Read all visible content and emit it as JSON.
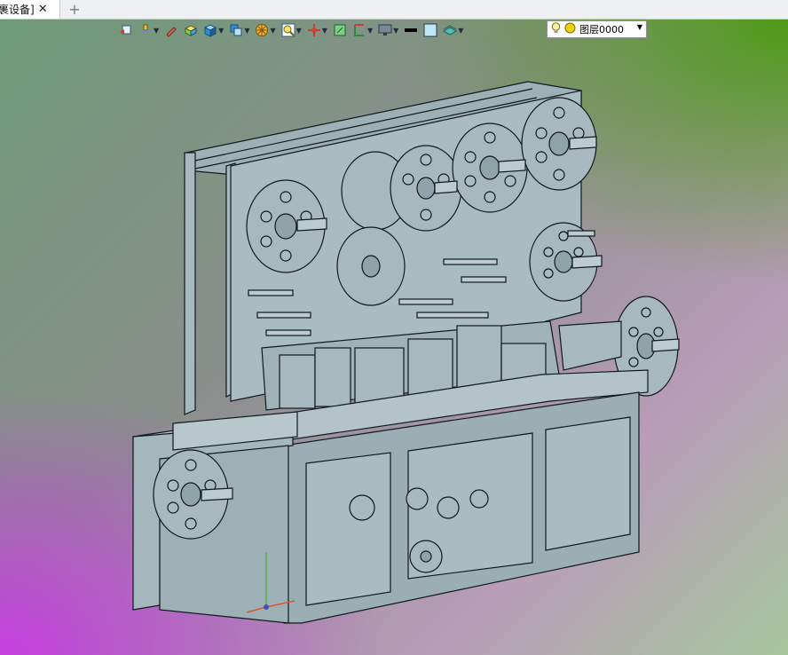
{
  "tab": {
    "title": "裹设备]",
    "close_glyph": "✕",
    "add_glyph": "+"
  },
  "toolbar": {
    "layer_label": "图层0000",
    "tools": [
      "view-icon",
      "pin-icon",
      "pencil-icon",
      "box-icon",
      "cube-icon",
      "layers-icon",
      "render-icon",
      "zoom-icon",
      "axis-icon",
      "plane-icon",
      "section-icon",
      "display-icon",
      "line-icon",
      "color-icon",
      "material-icon"
    ]
  },
  "colors": {
    "machine": "#a7b9bf",
    "outline": "#10181c"
  }
}
